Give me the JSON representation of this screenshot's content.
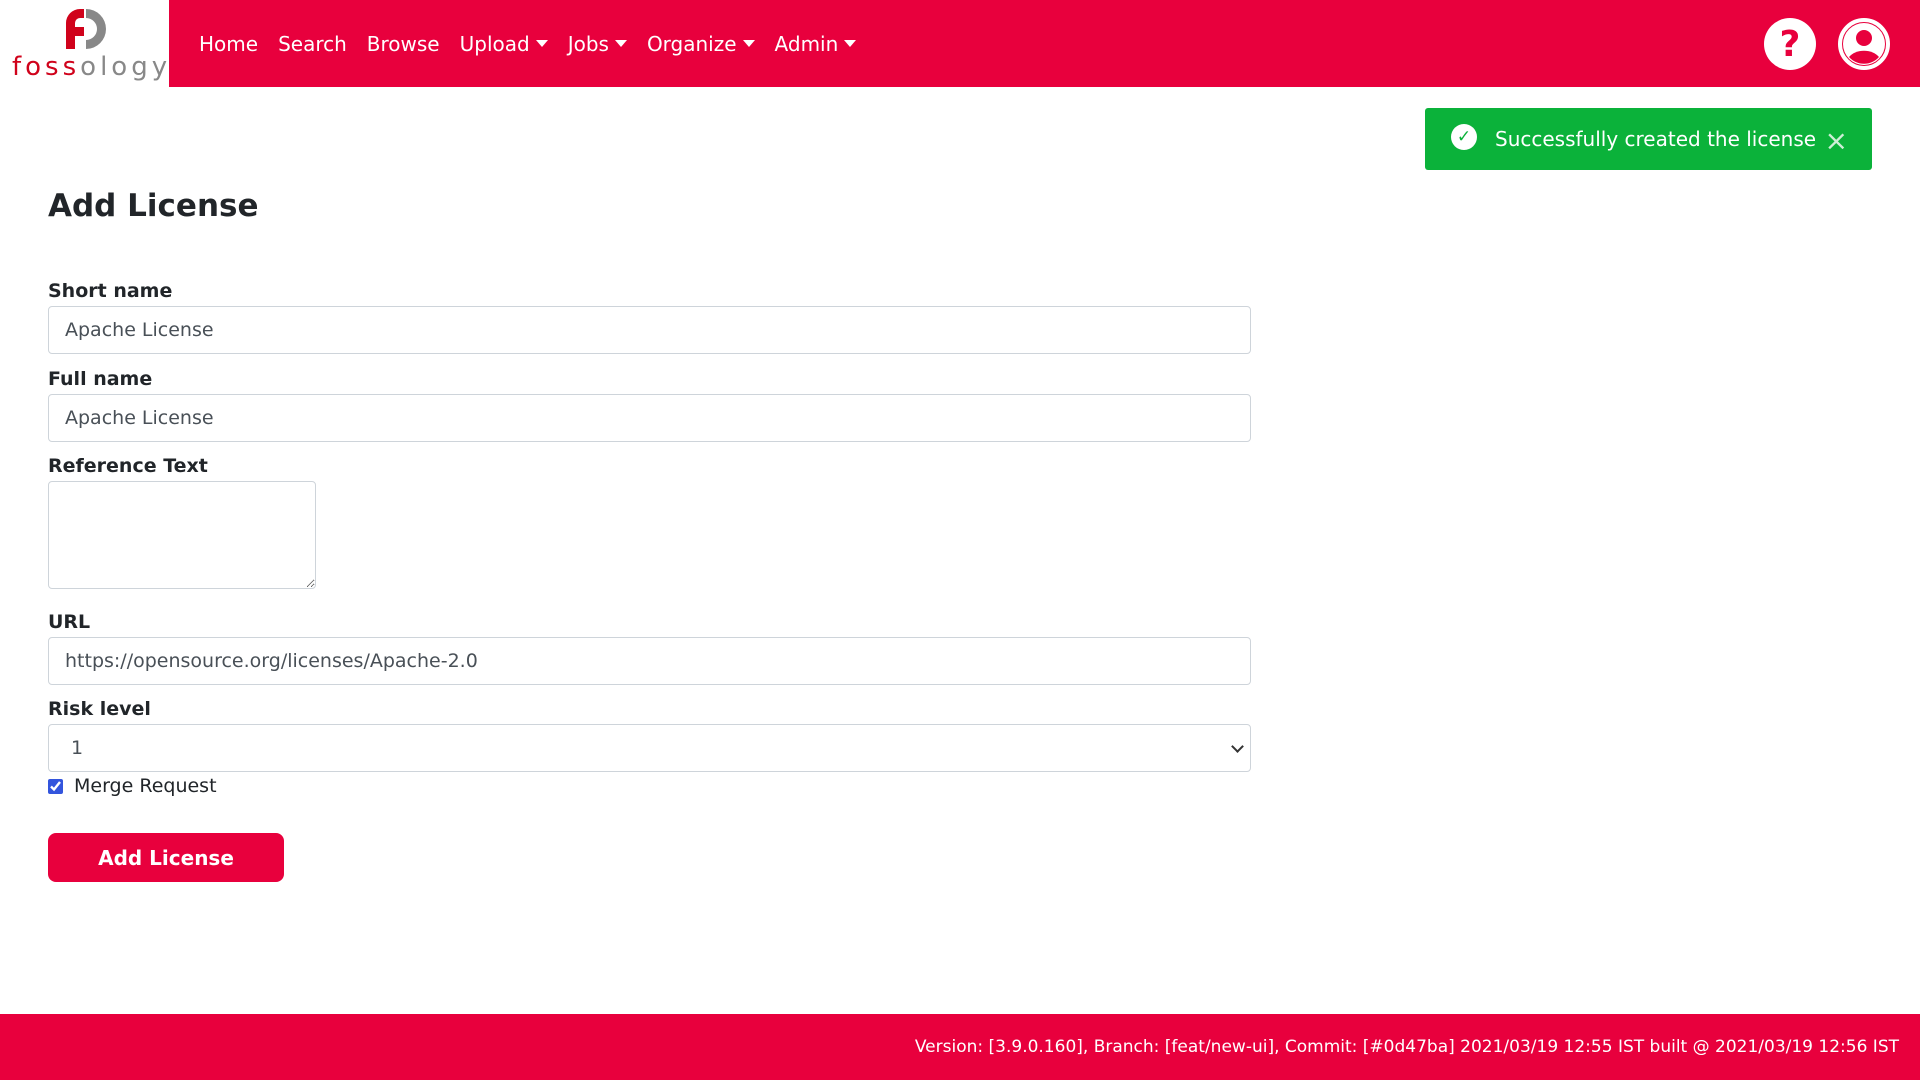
{
  "brand": {
    "logo_text_red": "foss",
    "logo_text_gray": "ology"
  },
  "nav": {
    "items": [
      {
        "label": "Home"
      },
      {
        "label": "Search"
      },
      {
        "label": "Browse"
      },
      {
        "label": "Upload",
        "dropdown": true
      },
      {
        "label": "Jobs",
        "dropdown": true
      },
      {
        "label": "Organize",
        "dropdown": true
      },
      {
        "label": "Admin",
        "dropdown": true
      }
    ],
    "help_icon": "?"
  },
  "toast": {
    "message": "Successfully created the license",
    "close": "×",
    "color": "#0bb23a"
  },
  "page": {
    "title": "Add License"
  },
  "form": {
    "short_name": {
      "label": "Short name",
      "value": "Apache License"
    },
    "full_name": {
      "label": "Full name",
      "value": "Apache License"
    },
    "reference_text": {
      "label": "Reference Text",
      "value": ""
    },
    "url": {
      "label": "URL",
      "value": "https://opensource.org/licenses/Apache-2.0"
    },
    "risk_level": {
      "label": "Risk level",
      "value": "1"
    },
    "merge_request": {
      "label": "Merge Request",
      "checked": true
    },
    "submit": "Add License"
  },
  "footer": {
    "text": "Version: [3.9.0.160], Branch: [feat/new-ui], Commit: [#0d47ba] 2021/03/19 12:55 IST built @ 2021/03/19 12:56 IST"
  },
  "colors": {
    "brand": "#e8003d"
  }
}
